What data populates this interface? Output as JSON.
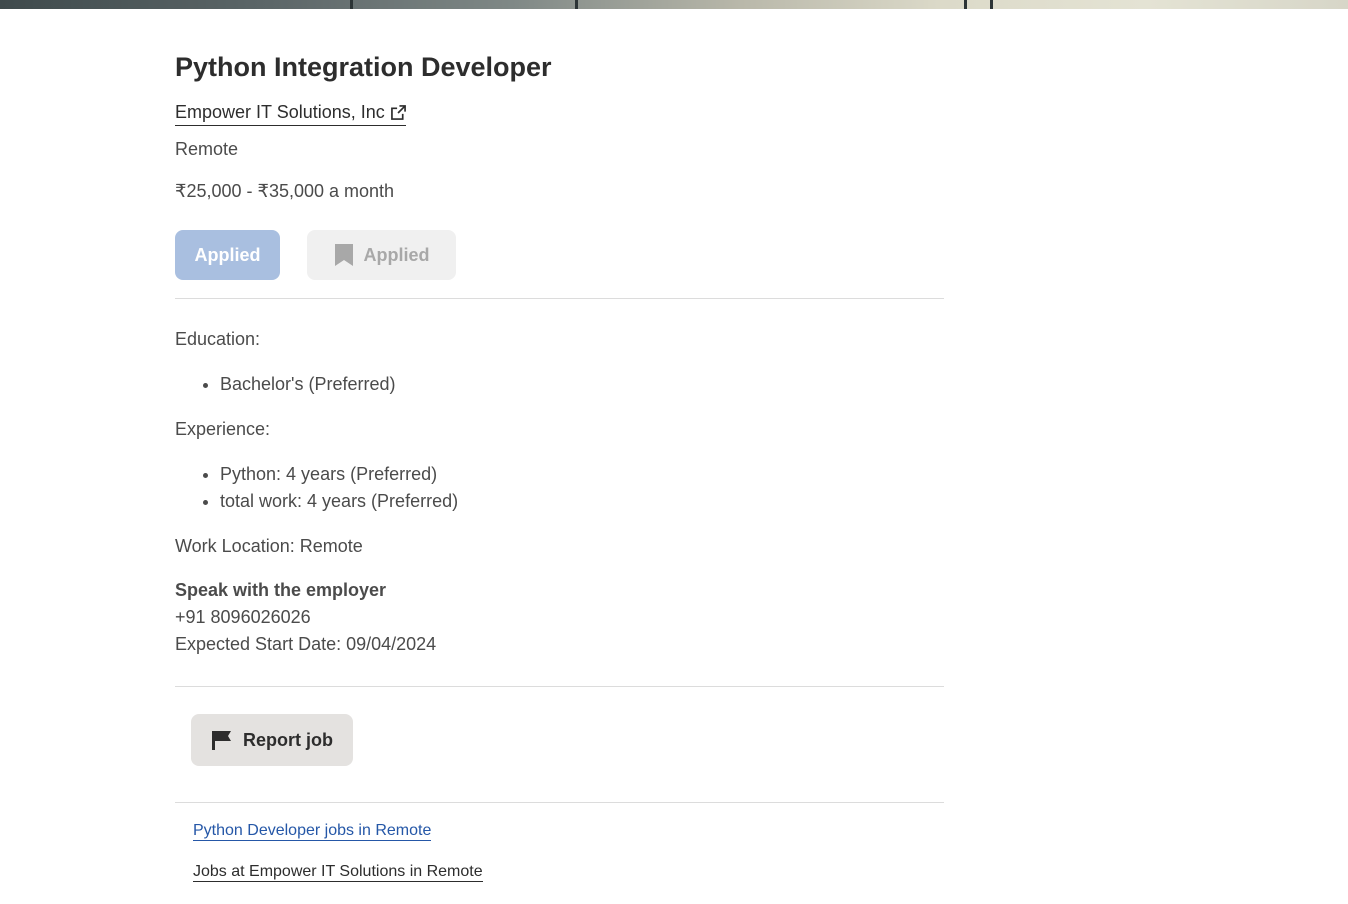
{
  "job": {
    "title": "Python Integration Developer",
    "company": "Empower IT Solutions, Inc",
    "location": "Remote",
    "salary": "₹25,000 - ₹35,000 a month"
  },
  "actions": {
    "apply_label": "Applied",
    "save_label": "Applied"
  },
  "details": {
    "education_label": "Education:",
    "education_items": [
      "Bachelor's (Preferred)"
    ],
    "experience_label": "Experience:",
    "experience_items": [
      "Python: 4 years (Preferred)",
      "total work: 4 years (Preferred)"
    ],
    "work_location": "Work Location: Remote"
  },
  "employer": {
    "heading": "Speak with the employer",
    "phone": "+91 8096026026",
    "start_date": "Expected Start Date: 09/04/2024"
  },
  "report": {
    "label": "Report job"
  },
  "related": {
    "links": [
      "Python Developer jobs in Remote",
      "Jobs at Empower IT Solutions in Remote"
    ]
  },
  "colors": {
    "primary_disabled": "#a9bfe0",
    "link_blue": "#2557a7",
    "text": "#2d2d2d"
  },
  "icons": [
    "external-link-icon",
    "bookmark-icon",
    "flag-icon"
  ]
}
